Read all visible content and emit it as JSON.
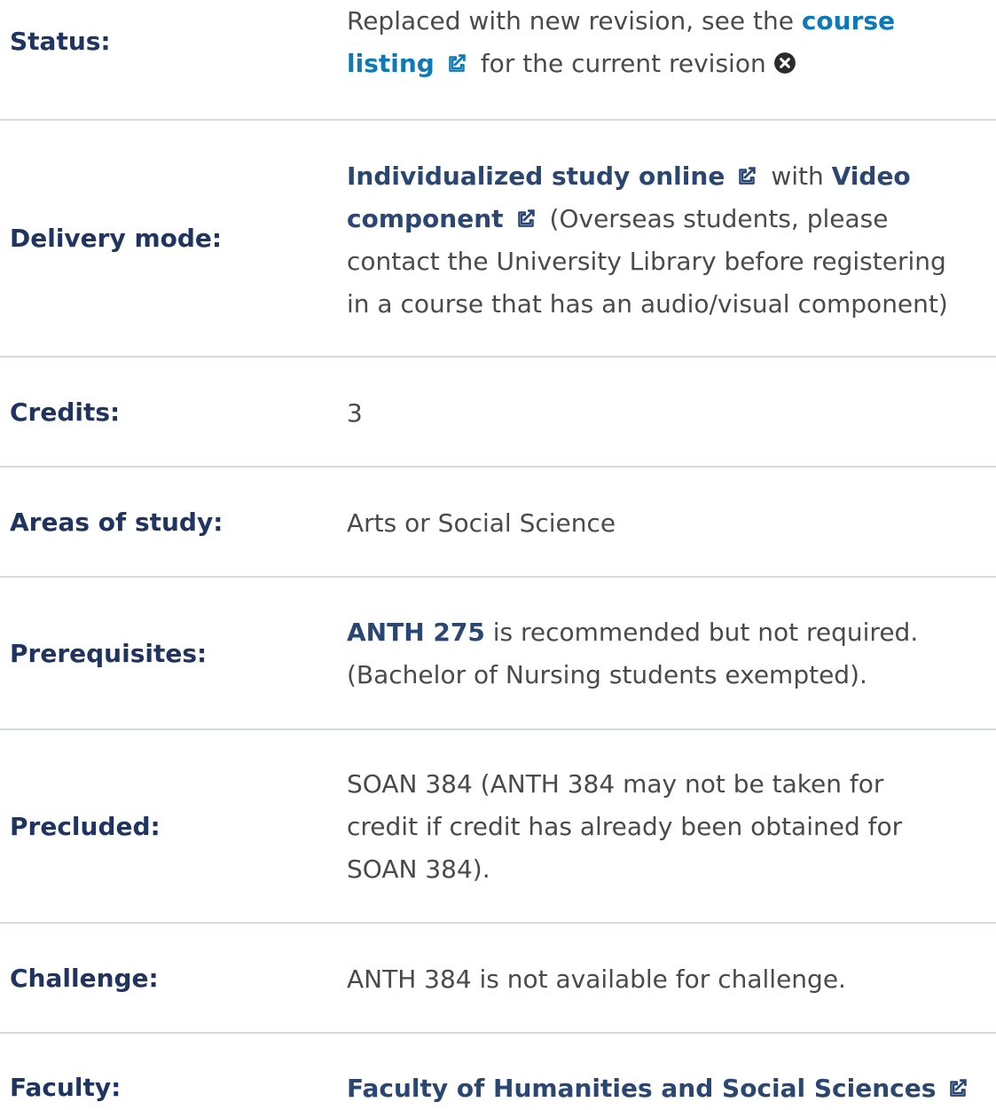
{
  "rows": {
    "status": {
      "label": "Status:",
      "text_before": "Replaced with new revision, see the ",
      "link_line1": "course",
      "link_line2": "listing",
      "text_after": "for the current revision"
    },
    "delivery": {
      "label": "Delivery mode:",
      "link1": "Individualized study online",
      "text_mid": "with ",
      "link2_line1": "Video",
      "link2_line2": "component",
      "note_line1": "(Overseas students, please",
      "note_line2": "contact the University Library before registering",
      "note_line3": "in a course that has an audio/visual component)"
    },
    "credits": {
      "label": "Credits:",
      "value": "3"
    },
    "areas": {
      "label": "Areas of study:",
      "value": "Arts or Social Science"
    },
    "prerequisites": {
      "label": "Prerequisites:",
      "link": "ANTH 275",
      "text_line1": " is recommended but not required.",
      "text_line2": "(Bachelor of Nursing students exempted)."
    },
    "precluded": {
      "label": "Precluded:",
      "line1": "SOAN 384 (ANTH 384 may not be taken for",
      "line2": "credit if credit has already been obtained for",
      "line3": "SOAN 384)."
    },
    "challenge": {
      "label": "Challenge:",
      "value": "ANTH 384 is not available for challenge."
    },
    "faculty": {
      "label": "Faculty:",
      "link": "Faculty of Humanities and Social Sciences"
    }
  },
  "colors": {
    "label": "#1f3460",
    "link_blue": "#0f79b7",
    "link_navy": "#2a4773",
    "text": "#4a4a4a",
    "divider": "#d3dae3"
  },
  "icons": {
    "external": "external-link-icon",
    "close": "close-circle-icon"
  }
}
